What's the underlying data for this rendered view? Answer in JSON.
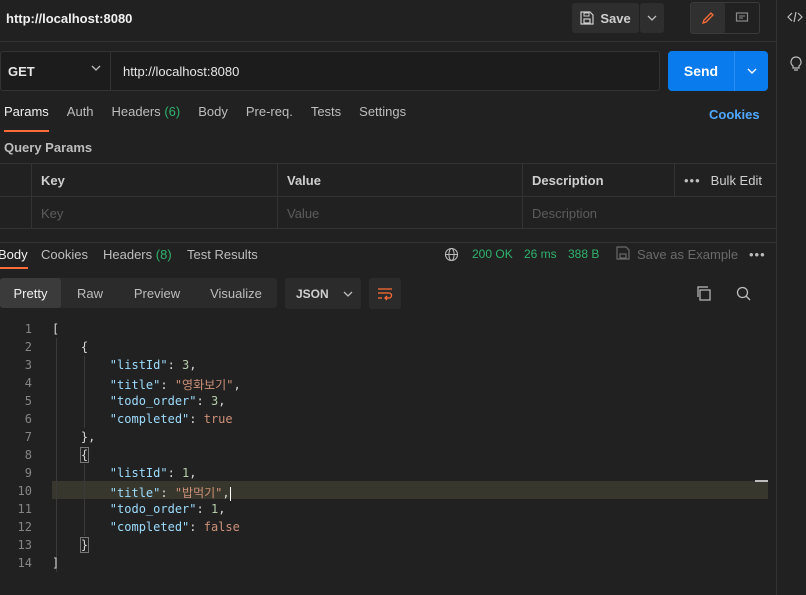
{
  "header": {
    "title": "http://localhost:8080",
    "save_label": "Save"
  },
  "request": {
    "method": "GET",
    "url": "http://localhost:8080",
    "send_label": "Send"
  },
  "request_tabs": [
    {
      "label": "Params",
      "active": true
    },
    {
      "label": "Auth"
    },
    {
      "label": "Headers",
      "count": "(6)"
    },
    {
      "label": "Body"
    },
    {
      "label": "Pre-req."
    },
    {
      "label": "Tests"
    },
    {
      "label": "Settings"
    }
  ],
  "cookies_label": "Cookies",
  "query_params": {
    "title": "Query Params",
    "headers": {
      "key": "Key",
      "value": "Value",
      "description": "Description",
      "bulk_edit": "Bulk Edit"
    },
    "placeholders": {
      "key": "Key",
      "value": "Value",
      "description": "Description"
    }
  },
  "response": {
    "tabs": [
      {
        "label": "Body",
        "active": true
      },
      {
        "label": "Cookies"
      },
      {
        "label": "Headers",
        "count": "(8)"
      },
      {
        "label": "Test Results"
      }
    ],
    "status": "200 OK",
    "time": "26 ms",
    "size": "388 B",
    "save_example": "Save as Example",
    "views": [
      "Pretty",
      "Raw",
      "Preview",
      "Visualize"
    ],
    "active_view": "Pretty",
    "format": "JSON"
  },
  "code_lines": [
    "1",
    "2",
    "3",
    "4",
    "5",
    "6",
    "7",
    "8",
    "9",
    "10",
    "11",
    "12",
    "13",
    "14"
  ],
  "json": {
    "items": [
      {
        "listId": "3",
        "title": "\"영화보기\"",
        "todo_order": "3",
        "completed": "true"
      },
      {
        "listId": "1",
        "title": "\"밥먹기\"",
        "todo_order": "1",
        "completed": "false"
      }
    ],
    "keys": {
      "listId": "\"listId\"",
      "title": "\"title\"",
      "todo_order": "\"todo_order\"",
      "completed": "\"completed\""
    }
  },
  "colors": {
    "accent": "#ff6c37",
    "send": "#097bed",
    "success": "#2fb36c",
    "link": "#4fa8ff"
  }
}
